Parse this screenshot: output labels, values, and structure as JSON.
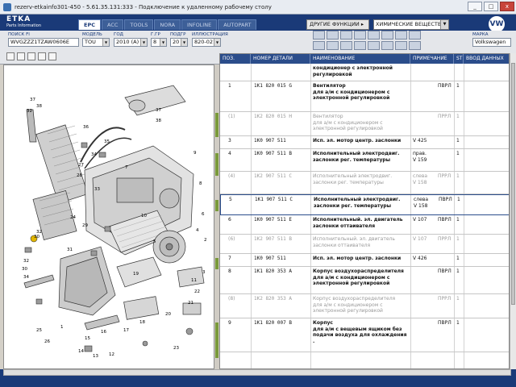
{
  "window": {
    "title": "rezerv-etkainfo301-450 - 5.61.35.131:333 - Подключение к удаленному рабочему столу",
    "buttons": [
      "_",
      "□",
      "x"
    ]
  },
  "brand": {
    "logo_main": "ETKA",
    "logo_sub": "Parts Information",
    "maker_logo": "VW"
  },
  "tabs": [
    {
      "label": "EPC",
      "active": true
    },
    {
      "label": "ACC",
      "active": false
    },
    {
      "label": "TOOLS",
      "active": false
    },
    {
      "label": "NORA",
      "active": false
    },
    {
      "label": "INFOLINE",
      "active": false
    },
    {
      "label": "AUTOPART",
      "active": false
    }
  ],
  "functions": {
    "other_label": "ДРУГИЕ ФУНКЦИИ ▸",
    "chem_value": "ХИМИЧЕСКИЕ ВЕЩЕСТВА"
  },
  "fields": {
    "vin": {
      "label": "ПОИСК FI",
      "value": "WVGZZZ1TZAW0606E"
    },
    "model": {
      "label": "МОДЕЛЬ",
      "value": "TOU"
    },
    "year": {
      "label": "ГОД",
      "value": "2010 (A)"
    },
    "group": {
      "label": "Г.ГР",
      "value": "8"
    },
    "subgroup": {
      "label": "ПОДГР",
      "value": "20"
    },
    "illustration": {
      "label": "ИЛЛЮСТРАЦИЯ",
      "value": "820-021"
    },
    "brand": {
      "label": "МАРКА",
      "value": "Volkswagen"
    }
  },
  "table": {
    "headers": [
      "ПОЗ.",
      "НОМЕР ДЕТАЛИ",
      "НАИМЕНОВАНИЕ",
      "ПРИМЕЧАНИЕ",
      "ST",
      "ВВОД ДАННЫХ"
    ],
    "rows": [
      {
        "pos": "",
        "part": "",
        "name": "кондиционер с электронной\nрегулировкой",
        "note": "",
        "qual": "",
        "st": "",
        "grey": false,
        "sel": false
      },
      {
        "pos": "1",
        "part": "1K1 820 015 G",
        "name": "Вентилятор\nдля а/м с кондиционером с\nэлектронной регулировкой",
        "note": "",
        "qual": "ПВРЛ",
        "st": "1",
        "grey": false,
        "sel": false
      },
      {
        "pos": "(1)",
        "part": "1K2 820 015 H",
        "name": "Вентилятор\nдля а/м с кондиционером с\nэлектронной регулировкой",
        "note": "",
        "qual": "ПРРЛ",
        "st": "1",
        "grey": true,
        "sel": false
      },
      {
        "pos": "3",
        "part": "1K0 907 511",
        "name": "Исп. эл. мотор центр. заслонки",
        "note": "V 425",
        "qual": "",
        "st": "1",
        "grey": false,
        "sel": false
      },
      {
        "pos": "4",
        "part": "1K0 907 511 B",
        "name": "Исполнительный электродвиг.\nзаслонки рег. температуры",
        "note": "прав.\nV 159",
        "qual": "",
        "st": "1",
        "grey": false,
        "sel": false
      },
      {
        "pos": "(4)",
        "part": "1K2 907 511 C",
        "name": "Исполнительный электродвиг.\nзаслонки рег. температуры",
        "note": "слева\nV 158",
        "qual": "ПРРЛ",
        "st": "1",
        "grey": true,
        "sel": false
      },
      {
        "pos": "5",
        "part": "1K1 907 511 C",
        "name": "Исполнительный электродвиг.\nзаслонки рег. температуры",
        "note": "слева\nV 158",
        "qual": "ПВРЛ",
        "st": "1",
        "grey": false,
        "sel": true
      },
      {
        "pos": "6",
        "part": "1K0 907 511 E",
        "name": "Исполнительный. эл. двигатель\nзаслонки оттаивателя",
        "note": "V 107",
        "qual": "ПВРЛ",
        "st": "1",
        "grey": false,
        "sel": false
      },
      {
        "pos": "(6)",
        "part": "1K2 907 511 B",
        "name": "Исполнительный. эл. двигатель\nзаслонки оттаивателя",
        "note": "V 107",
        "qual": "ПРРЛ",
        "st": "1",
        "grey": true,
        "sel": false
      },
      {
        "pos": "7",
        "part": "1K0 907 511",
        "name": "Исп. эл. мотор центр. заслонки",
        "note": "V 426",
        "qual": "",
        "st": "1",
        "grey": false,
        "sel": false
      },
      {
        "pos": "8",
        "part": "1K1 820 353 A",
        "name": "Корпус воздухораспределителя\nдля а/м с кондиционером с\nэлектронной регулировкой",
        "note": "",
        "qual": "ПВРЛ",
        "st": "1",
        "grey": false,
        "sel": false
      },
      {
        "pos": "(8)",
        "part": "1K2 820 353 A",
        "name": "Корпус воздухораспределителя\nдля а/м с кондиционером с\nэлектронной регулировкой",
        "note": "",
        "qual": "ПРРЛ",
        "st": "1",
        "grey": true,
        "sel": false
      },
      {
        "pos": "9",
        "part": "1K1 820 007 B",
        "name": "Корпус\nдля а/м с вещевым ящиком без\nподачи воздуха для охлаждения\n.",
        "note": "",
        "qual": "ПВРЛ",
        "st": "1",
        "grey": false,
        "sel": false
      }
    ]
  },
  "diagram": {
    "callouts": [
      "37",
      "38",
      "32",
      "30",
      "36",
      "35",
      "34",
      "33",
      "27",
      "28",
      "24",
      "31",
      "29",
      "21",
      "22",
      "23",
      "25",
      "26",
      "20",
      "19",
      "18",
      "17",
      "16",
      "15",
      "14",
      "13",
      "12",
      "11",
      "10",
      "9",
      "8",
      "7",
      "6",
      "5",
      "4",
      "3",
      "1",
      "2"
    ]
  }
}
